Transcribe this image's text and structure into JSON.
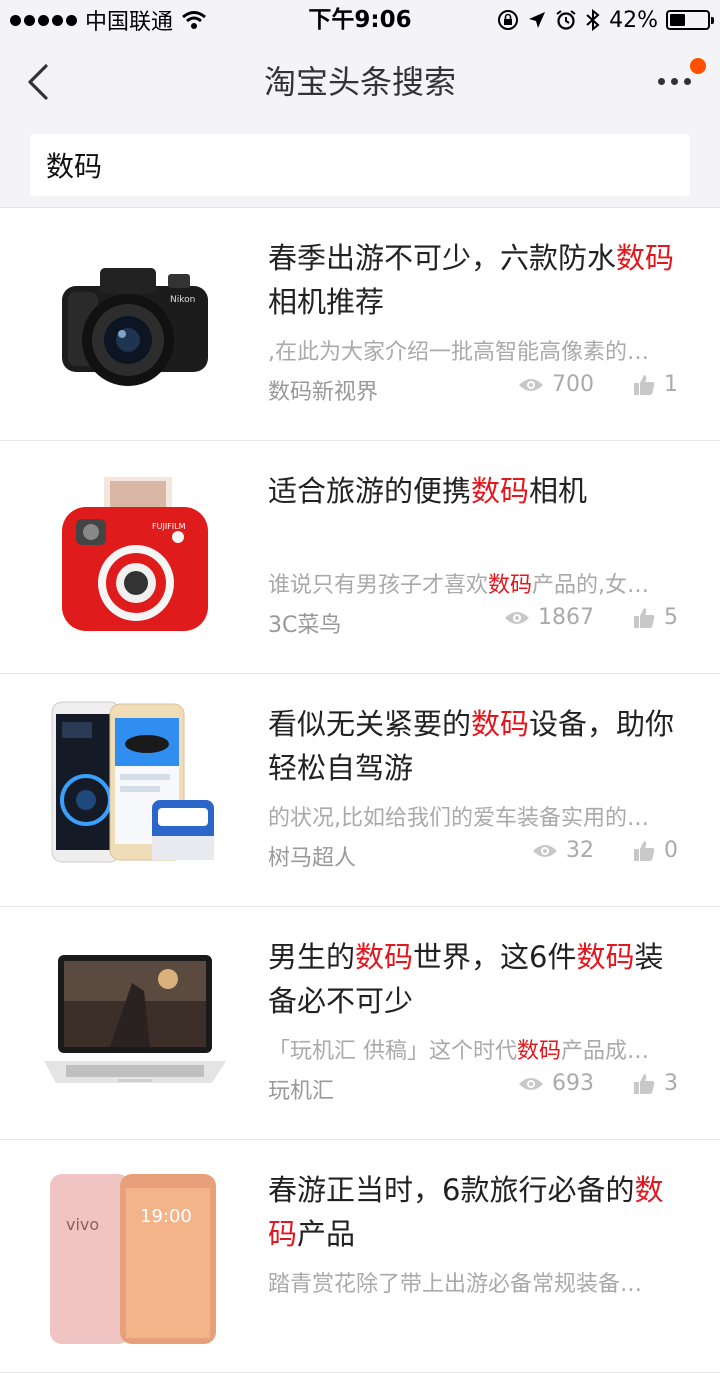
{
  "status_bar": {
    "carrier": "中国联通",
    "time": "下午9:06",
    "battery_percent": "42%",
    "battery_level": 0.42
  },
  "nav": {
    "title": "淘宝头条搜索",
    "back_icon": "chevron-left-icon",
    "more_icon": "more-dots-icon",
    "badge_color": "#ff5000"
  },
  "search": {
    "value": "数码"
  },
  "colors": {
    "highlight": "#e3171d"
  },
  "articles": [
    {
      "title_parts": [
        "春季出游不可少，六款防水",
        "数码",
        "相机推荐"
      ],
      "summary_parts": [
        ",在此为大家介绍一批高智能高像素的…",
        "",
        ""
      ],
      "source": "数码新视界",
      "views": "700",
      "likes": "1",
      "thumb": "camera-nikon-thumb"
    },
    {
      "title_parts": [
        "适合旅游的便携",
        "数码",
        "相机"
      ],
      "summary_parts": [
        "谁说只有男孩子才喜欢",
        "数码",
        "产品的,女…"
      ],
      "source": "3C菜鸟",
      "views": "1867",
      "likes": "5",
      "thumb": "instax-camera-thumb"
    },
    {
      "title_parts": [
        "看似无关紧要的",
        "数码",
        "设备，助你轻松自驾游"
      ],
      "summary_parts": [
        "的状况,比如给我们的爱车装备实用的…",
        "",
        ""
      ],
      "source": "树马超人",
      "views": "32",
      "likes": "0",
      "thumb": "car-gadget-thumb"
    },
    {
      "title_parts": [
        "男生的",
        "数码",
        "世界，这6件",
        "数码",
        "装备必不可少"
      ],
      "summary_parts": [
        "「玩机汇 供稿」这个时代",
        "数码",
        "产品成…"
      ],
      "source": "玩机汇",
      "views": "693",
      "likes": "3",
      "thumb": "laptop-thumb"
    },
    {
      "title_parts": [
        "春游正当时，6款旅行必备的",
        "数码",
        "产品"
      ],
      "summary_parts": [
        "踏青赏花除了带上出游必备常规装备…",
        "",
        ""
      ],
      "source": "",
      "views": "",
      "likes": "",
      "thumb": "phones-thumb"
    }
  ]
}
